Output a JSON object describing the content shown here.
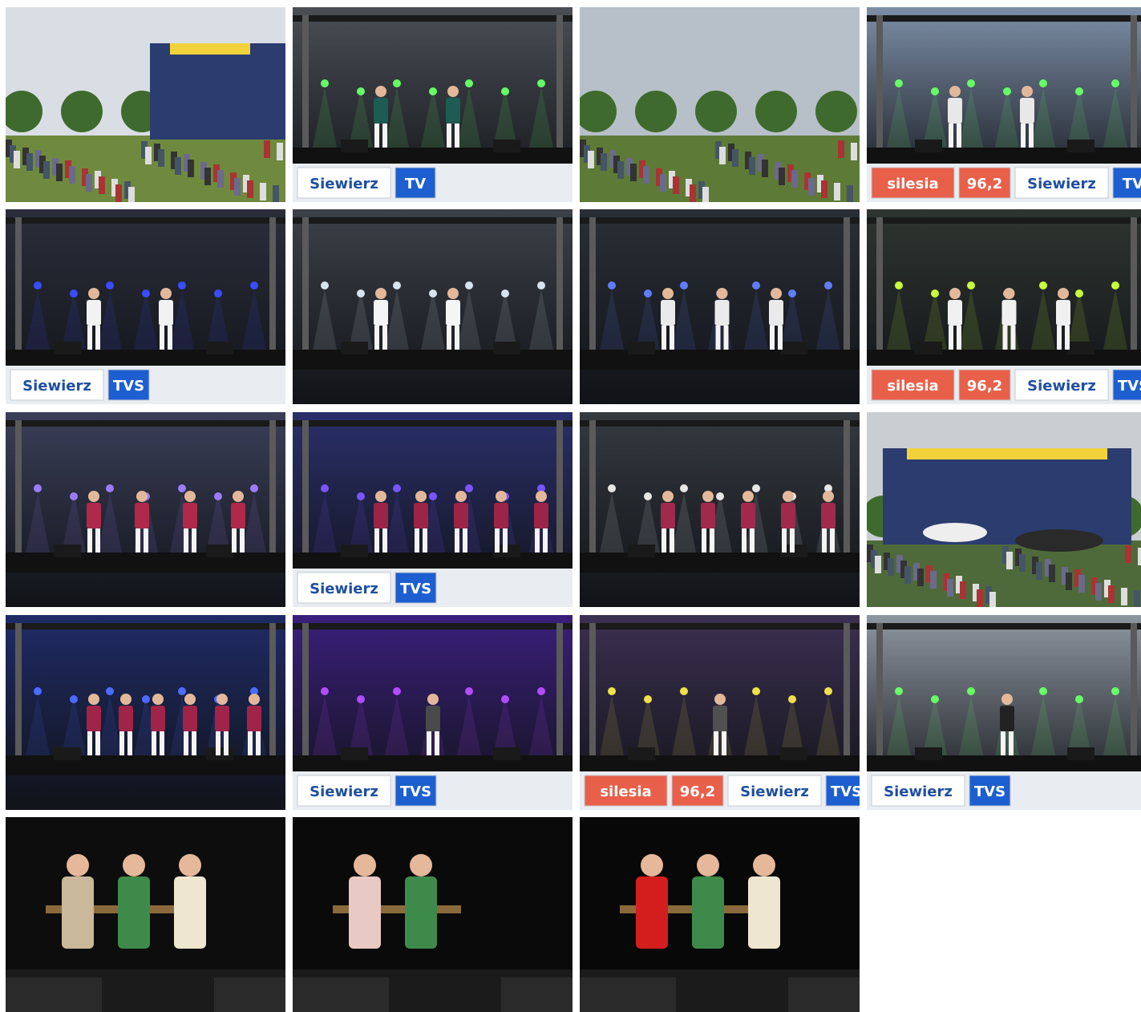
{
  "gallery": {
    "photos": [
      {
        "kind": "day-crowd",
        "stage": true,
        "sky": "#d9dee4",
        "ground": "#6f8a3e"
      },
      {
        "kind": "stage-dusk",
        "sky": "#4a4f55",
        "performers": 2,
        "outfit": "#1d5c52",
        "banner": [
          "Siewierz",
          "TV"
        ]
      },
      {
        "kind": "day-crowd",
        "stage": false,
        "sky": "#b7c0c9",
        "ground": "#5d7a37"
      },
      {
        "kind": "stage-day",
        "sky": "#7c8ea6",
        "performers": 2,
        "outfit": "#e8e8e8",
        "banner": [
          "silesia",
          "96,2",
          "Siewierz",
          "TV"
        ]
      },
      {
        "kind": "stage-night",
        "sky": "#2b2e3a",
        "light": "#3b4cff",
        "performers": 2,
        "outfit": "#f2f2f2",
        "banner": [
          "Siewierz",
          "TVS"
        ]
      },
      {
        "kind": "stage-night",
        "sky": "#3c4048",
        "light": "#d7e3ef",
        "performers": 2,
        "outfit": "#f5f5f5",
        "banner": []
      },
      {
        "kind": "stage-night",
        "sky": "#2a2f36",
        "light": "#5f7dff",
        "performers": 3,
        "outfit": "#eaeaea",
        "banner": []
      },
      {
        "kind": "stage-night",
        "sky": "#2e3530",
        "light": "#c8ff3a",
        "performers": 3,
        "outfit": "#f0f0f0",
        "banner": [
          "silesia",
          "96,2",
          "Siewierz",
          "TVS"
        ]
      },
      {
        "kind": "stage-night",
        "sky": "#3a3f58",
        "light": "#9a7cff",
        "performers": 4,
        "outfit": "#b0294a",
        "banner": []
      },
      {
        "kind": "stage-night",
        "sky": "#2a2f6a",
        "light": "#7a55ff",
        "performers": 5,
        "outfit": "#9c2446",
        "banner": [
          "Siewierz",
          "TVS"
        ]
      },
      {
        "kind": "stage-night",
        "sky": "#343a40",
        "light": "#e6e6e6",
        "performers": 5,
        "outfit": "#a12a4c",
        "banner": []
      },
      {
        "kind": "rain-crowd",
        "sky": "#c9ced3",
        "ground": "#4f6a3a"
      },
      {
        "kind": "stage-night",
        "sky": "#1f2b66",
        "light": "#4c6bff",
        "performers": 6,
        "outfit": "#a02448",
        "banner": []
      },
      {
        "kind": "stage-night",
        "sky": "#3a1f7a",
        "light": "#b24cff",
        "performers": 1,
        "outfit": "#4a4a4a",
        "banner": [
          "Siewierz",
          "TVS"
        ]
      },
      {
        "kind": "stage-night",
        "sky": "#3b3050",
        "light": "#f0e04a",
        "performers": 1,
        "outfit": "#505050",
        "banner": [
          "silesia",
          "96,2",
          "Siewierz",
          "TVS"
        ]
      },
      {
        "kind": "stage-day",
        "sky": "#8e96a0",
        "performers": 1,
        "outfit": "#222222",
        "banner": [
          "Siewierz",
          "TVS"
        ]
      },
      {
        "kind": "theatre",
        "sky": "#0d0d0d",
        "performers": 3,
        "outfit": "#c9b89a",
        "banner": []
      },
      {
        "kind": "theatre",
        "sky": "#0a0a0a",
        "performers": 2,
        "outfit": "#e8c9c4",
        "banner": []
      },
      {
        "kind": "theatre",
        "sky": "#080808",
        "performers": 3,
        "outfit": "#d41e1e",
        "banner": []
      }
    ]
  }
}
